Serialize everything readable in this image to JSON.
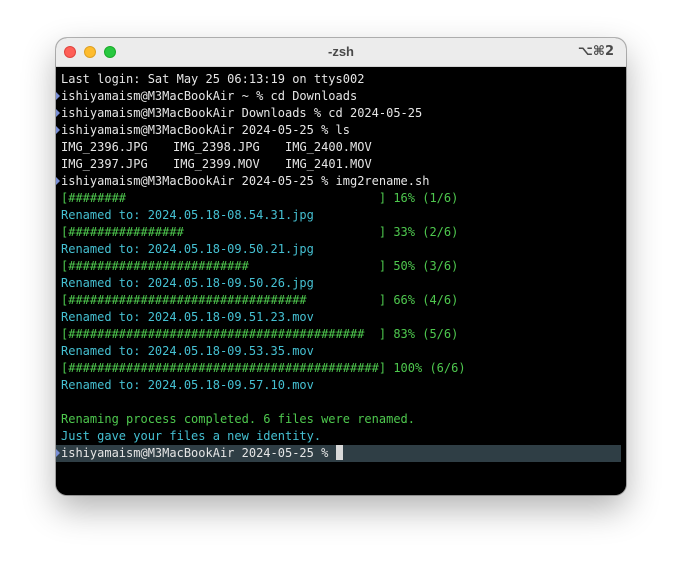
{
  "window": {
    "title": "-zsh",
    "shortcut": "⌥⌘2"
  },
  "terminal": {
    "login": "Last login: Sat May 25 06:13:19 on ttys002",
    "commands": [
      "ishiyamaism@M3MacBookAir ~ % cd Downloads",
      "ishiyamaism@M3MacBookAir Downloads % cd 2024-05-25",
      "ishiyamaism@M3MacBookAir 2024-05-25 % ls",
      "ishiyamaism@M3MacBookAir 2024-05-25 % img2rename.sh"
    ],
    "ls_rows": [
      [
        "IMG_2396.JPG",
        "IMG_2398.JPG",
        "IMG_2400.MOV"
      ],
      [
        "IMG_2397.JPG",
        "IMG_2399.MOV",
        "IMG_2401.MOV"
      ]
    ],
    "progress": [
      {
        "bar": "[########                                   ] 16% (1/6)",
        "renamed": "Renamed to: 2024.05.18-08.54.31.jpg"
      },
      {
        "bar": "[################                           ] 33% (2/6)",
        "renamed": "Renamed to: 2024.05.18-09.50.21.jpg"
      },
      {
        "bar": "[#########################                  ] 50% (3/6)",
        "renamed": "Renamed to: 2024.05.18-09.50.26.jpg"
      },
      {
        "bar": "[#################################          ] 66% (4/6)",
        "renamed": "Renamed to: 2024.05.18-09.51.23.mov"
      },
      {
        "bar": "[#########################################  ] 83% (5/6)",
        "renamed": "Renamed to: 2024.05.18-09.53.35.mov"
      },
      {
        "bar": "[###########################################] 100% (6/6)",
        "renamed": "Renamed to: 2024.05.18-09.57.10.mov"
      }
    ],
    "completion": "Renaming process completed. 6 files were renamed.",
    "tagline": "Just gave your files a new identity.",
    "current_prompt": "ishiyamaism@M3MacBookAir 2024-05-25 % "
  },
  "colors": {
    "default_text": "#e6e6e6",
    "progress_green": "#4ec84e",
    "renamed_cyan": "#45c0d2",
    "prompt_marker": "#7a8fd6",
    "active_line_bg": "#2f3e45"
  },
  "icons": {
    "close": "close-button-icon",
    "minimize": "minimize-button-icon",
    "maximize": "maximize-button-icon",
    "prompt_marker": "prompt-marker-icon",
    "cursor": "text-cursor-icon"
  }
}
